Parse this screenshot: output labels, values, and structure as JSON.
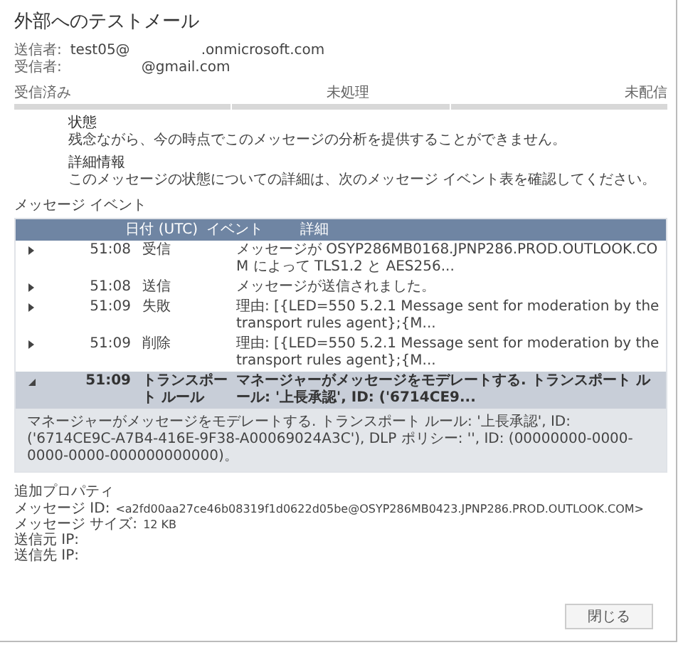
{
  "window": {
    "title": "外部へのテストメール"
  },
  "sender": {
    "label": "送信者:",
    "value_start": "test05@",
    "value_end": ".onmicrosoft.com"
  },
  "recipient": {
    "label": "受信者:",
    "value_end": "@gmail.com"
  },
  "stages": [
    "受信済み",
    "未処理",
    "未配信"
  ],
  "status": {
    "heading": "状態",
    "text": "残念ながら、今の時点でこのメッセージの分析を提供することができません。"
  },
  "details": {
    "heading": "詳細情報",
    "text": "このメッセージの状態についての詳細は、次のメッセージ イベント表を確認してください。"
  },
  "events": {
    "title": "メッセージ イベント",
    "columns": [
      "日付 (UTC)",
      "イベント",
      "詳細"
    ],
    "rows": [
      {
        "date": "51:08",
        "event": "受信",
        "detail": "メッセージが OSYP286MB0168.JPNP286.PROD.OUTLOOK.COM によって TLS1.2 と AES256...",
        "expanded": false,
        "selected": false
      },
      {
        "date": "51:08",
        "event": "送信",
        "detail": "メッセージが送信されました。",
        "expanded": false,
        "selected": false
      },
      {
        "date": "51:09",
        "event": "失敗",
        "detail": "理由: [{LED=550 5.2.1 Message sent for moderation by the transport rules agent};{M...",
        "expanded": false,
        "selected": false
      },
      {
        "date": "51:09",
        "event": "削除",
        "detail": "理由: [{LED=550 5.2.1 Message sent for moderation by the transport rules agent};{M...",
        "expanded": false,
        "selected": false
      },
      {
        "date": "51:09",
        "event": "トランスポート ルール",
        "detail": "マネージャーがメッセージをモデレートする. トランスポート ルール: '上長承認', ID: ('6714CE9...",
        "expanded": true,
        "selected": true,
        "expanded_text": "マネージャーがメッセージをモデレートする. トランスポート ルール: '上長承認', ID: ('6714CE9C-A7B4-416E-9F38-A00069024A3C'), DLP ポリシー: '', ID: (00000000-0000-0000-0000-000000000000)。"
      }
    ]
  },
  "properties": {
    "title": "追加プロパティ",
    "items": [
      {
        "label": "メッセージ ID:",
        "value": "<a2fd00aa27ce46b08319f1d0622d05be@OSYP286MB0423.JPNP286.PROD.OUTLOOK.COM>"
      },
      {
        "label": "メッセージ サイズ:",
        "value": "12 KB"
      },
      {
        "label": "送信元 IP:",
        "value": ""
      },
      {
        "label": "送信先 IP:",
        "value": ""
      }
    ]
  },
  "buttons": [
    "閉じる"
  ]
}
